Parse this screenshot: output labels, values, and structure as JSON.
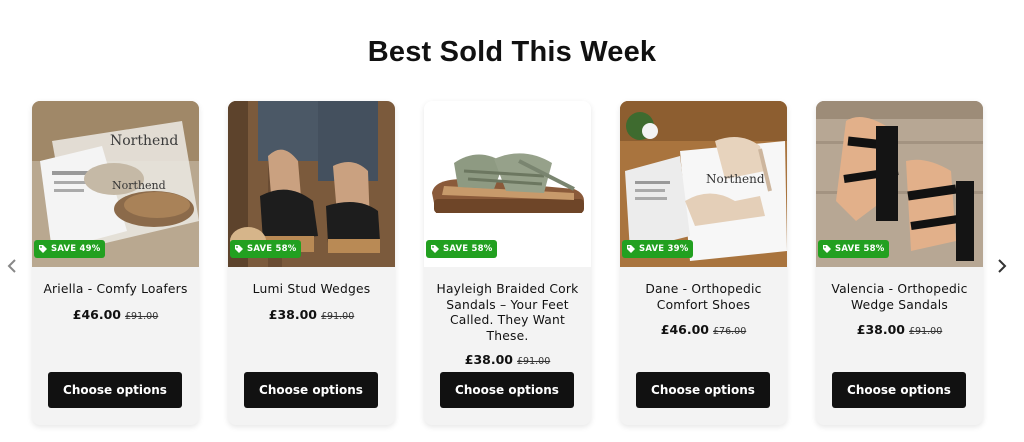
{
  "section": {
    "title": "Best Sold This Week"
  },
  "carousel": {
    "prev_icon": "chevron-left-icon",
    "next_icon": "chevron-right-icon"
  },
  "products": [
    {
      "title": "Ariella - Comfy Loafers",
      "price": "£46.00",
      "compare_price": "£91.00",
      "badge": "SAVE 49%",
      "button": "Choose options"
    },
    {
      "title": "Lumi Stud Wedges",
      "price": "£38.00",
      "compare_price": "£91.00",
      "badge": "SAVE 58%",
      "button": "Choose options"
    },
    {
      "title": "Hayleigh Braided Cork Sandals – Your Feet Called. They Want These.",
      "price": "£38.00",
      "compare_price": "£91.00",
      "badge": "SAVE 58%",
      "button": "Choose options"
    },
    {
      "title": "Dane - Orthopedic Comfort Shoes",
      "price": "£46.00",
      "compare_price": "£76.00",
      "badge": "SAVE 39%",
      "button": "Choose options"
    },
    {
      "title": "Valencia - Orthopedic Wedge Sandals",
      "price": "£38.00",
      "compare_price": "£91.00",
      "badge": "SAVE 58%",
      "button": "Choose options"
    }
  ],
  "image_brand_text": "Northend",
  "colors": {
    "badge": "#22a020",
    "button": "#111111",
    "card": "#f3f3f3"
  }
}
